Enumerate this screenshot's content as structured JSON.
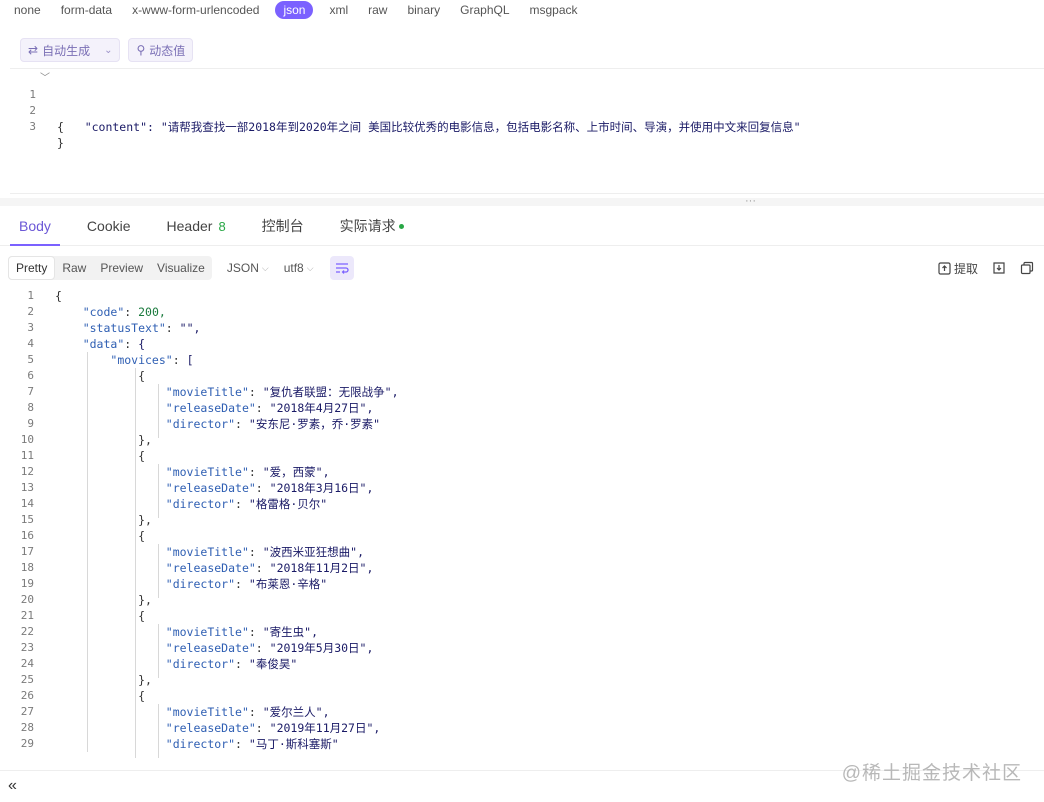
{
  "body_types": [
    "none",
    "form-data",
    "x-www-form-urlencoded",
    "json",
    "xml",
    "raw",
    "binary",
    "GraphQL",
    "msgpack"
  ],
  "body_type_active": "json",
  "request_toolbar": {
    "auto_generate": "自动生成",
    "dynamic_value": "动态值"
  },
  "request_editor": {
    "line_numbers": [
      "1",
      "2",
      "3"
    ],
    "lines": [
      "{",
      "    \"content\": \"请帮我查找一部2018年到2020年之间 美国比较优秀的电影信息，包括电影名称、上市时间、导演，并使用中文来回复信息\"",
      "}"
    ]
  },
  "response_tabs": {
    "body": "Body",
    "cookie": "Cookie",
    "header": "Header",
    "header_count": "8",
    "console": "控制台",
    "actual_request": "实际请求"
  },
  "response_toolbar": {
    "views": [
      "Pretty",
      "Raw",
      "Preview",
      "Visualize"
    ],
    "active_view": "Pretty",
    "format": "JSON",
    "encoding": "utf8",
    "extract": "提取"
  },
  "response_editor": {
    "line_numbers": [
      "1",
      "2",
      "3",
      "4",
      "5",
      "6",
      "7",
      "8",
      "9",
      "10",
      "11",
      "12",
      "13",
      "14",
      "15",
      "16",
      "17",
      "18",
      "19",
      "20",
      "21",
      "22",
      "23",
      "24",
      "25",
      "26",
      "27",
      "28",
      "29"
    ],
    "lines": [
      "{",
      "    \"code\": 200,",
      "    \"statusText\": \"\",",
      "    \"data\": {",
      "        \"movices\": [",
      "            {",
      "                \"movieTitle\": \"复仇者联盟：无限战争\",",
      "                \"releaseDate\": \"2018年4月27日\",",
      "                \"director\": \"安东尼·罗素，乔·罗素\"",
      "            },",
      "            {",
      "                \"movieTitle\": \"爱，西蒙\",",
      "                \"releaseDate\": \"2018年3月16日\",",
      "                \"director\": \"格雷格·贝尔\"",
      "            },",
      "            {",
      "                \"movieTitle\": \"波西米亚狂想曲\",",
      "                \"releaseDate\": \"2018年11月2日\",",
      "                \"director\": \"布莱恩·辛格\"",
      "            },",
      "            {",
      "                \"movieTitle\": \"寄生虫\",",
      "                \"releaseDate\": \"2019年5月30日\",",
      "                \"director\": \"奉俊昊\"",
      "            },",
      "            {",
      "                \"movieTitle\": \"爱尔兰人\",",
      "                \"releaseDate\": \"2019年11月27日\",",
      "                \"director\": \"马丁·斯科塞斯\""
    ]
  },
  "watermark": "@稀土掘金技术社区",
  "collapse_glyph": "«"
}
